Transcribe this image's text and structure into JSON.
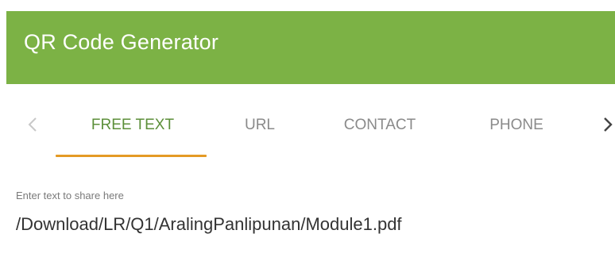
{
  "app": {
    "title": "QR Code Generator",
    "header_color": "#7cb245",
    "accent_color": "#e49a25",
    "active_tab_color": "#5c8f3a"
  },
  "tabs": {
    "prev_icon": "chevron-left-icon",
    "next_icon": "chevron-right-icon",
    "items": [
      {
        "label": "FREE TEXT",
        "active": true
      },
      {
        "label": "URL",
        "active": false
      },
      {
        "label": "CONTACT",
        "active": false
      },
      {
        "label": "PHONE",
        "active": false
      }
    ]
  },
  "text_field": {
    "label": "Enter text to share here",
    "value": "/Download/LR/Q1/AralingPanlipunan/Module1.pdf"
  }
}
